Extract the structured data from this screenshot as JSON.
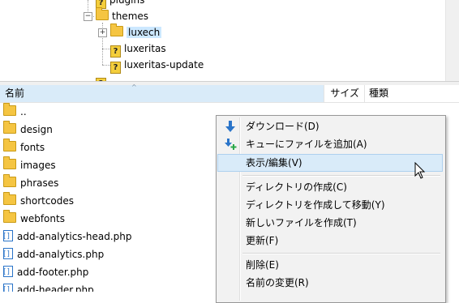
{
  "tree": {
    "nodes": [
      {
        "label": "plugins",
        "icon": "unknown"
      },
      {
        "label": "themes",
        "icon": "folder-open",
        "expander": "−"
      },
      {
        "label": "luxech",
        "icon": "folder",
        "expander": "+"
      },
      {
        "label": "luxeritas",
        "icon": "unknown"
      },
      {
        "label": "luxeritas-update",
        "icon": "unknown"
      }
    ]
  },
  "header": {
    "name": "名前",
    "size": "サイズ",
    "type": "種類",
    "sort_arrow": "^"
  },
  "files": [
    {
      "name": "..",
      "icon": "folder"
    },
    {
      "name": "design",
      "icon": "folder"
    },
    {
      "name": "fonts",
      "icon": "folder"
    },
    {
      "name": "images",
      "icon": "folder"
    },
    {
      "name": "phrases",
      "icon": "folder"
    },
    {
      "name": "shortcodes",
      "icon": "folder"
    },
    {
      "name": "webfonts",
      "icon": "folder"
    },
    {
      "name": "add-analytics-head.php",
      "icon": "php-file"
    },
    {
      "name": "add-analytics.php",
      "icon": "php-file"
    },
    {
      "name": "add-footer.php",
      "icon": "php-file"
    },
    {
      "name": "add-header.php",
      "icon": "php-file"
    }
  ],
  "context_menu": {
    "items": [
      {
        "label": "ダウンロード(D)",
        "icon": "download-arrow-icon"
      },
      {
        "label": "キューにファイルを追加(A)",
        "icon": "add-to-queue-icon"
      },
      {
        "label": "表示/編集(V)",
        "highlighted": true
      },
      {
        "label": "ディレクトリの作成(C)"
      },
      {
        "label": "ディレクトリを作成して移動(Y)"
      },
      {
        "label": "新しいファイルを作成(T)"
      },
      {
        "label": "更新(F)"
      },
      {
        "label": "削除(E)"
      },
      {
        "label": "名前の変更(R)"
      }
    ]
  },
  "colors": {
    "selection": "#cce8ff",
    "menu_highlight": "#d9ebf9",
    "folder": "#f5c542",
    "icon_blue": "#2a74c9"
  }
}
